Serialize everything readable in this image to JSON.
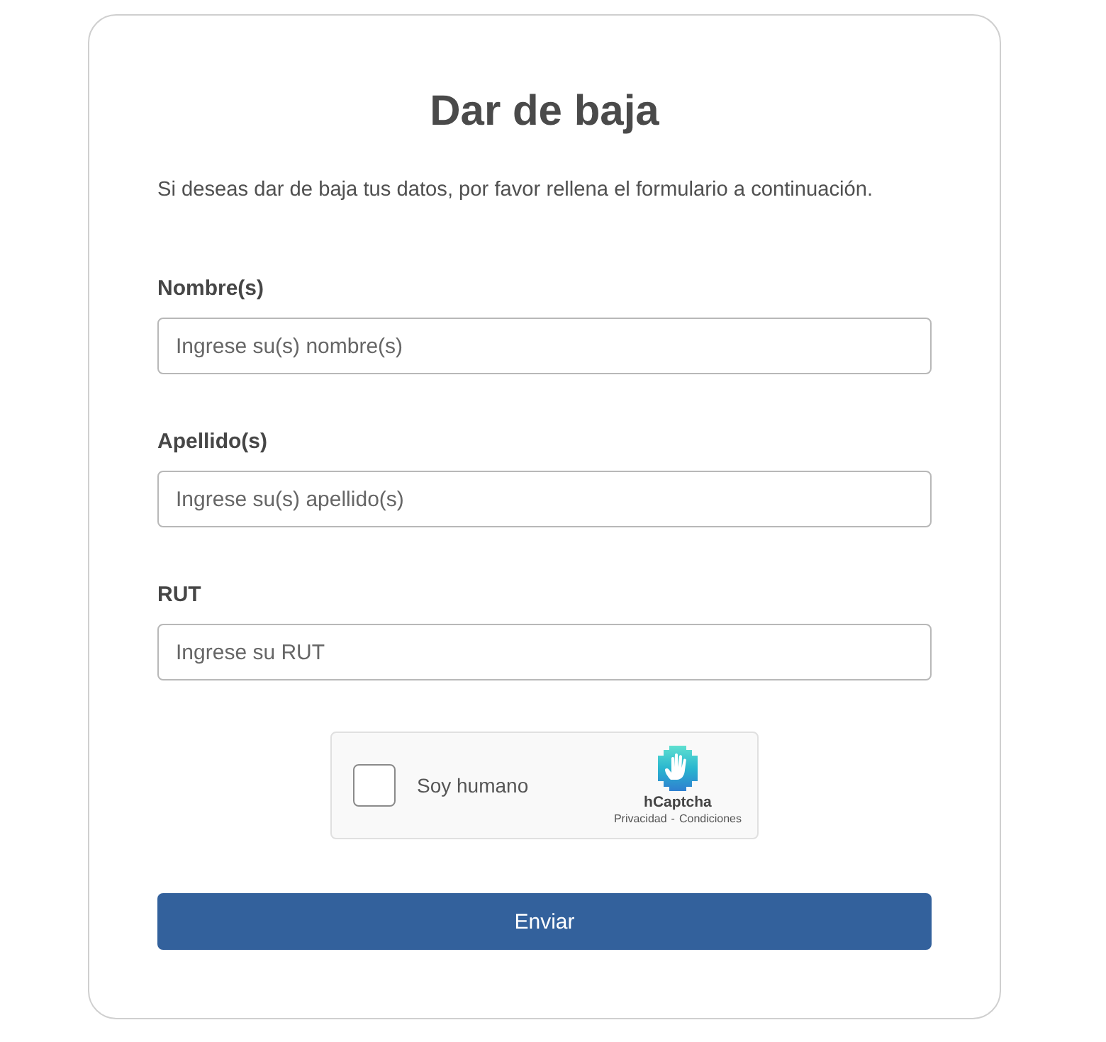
{
  "form": {
    "title": "Dar de baja",
    "intro": "Si deseas dar de baja tus datos, por favor rellena el formulario a continuación."
  },
  "fields": [
    {
      "label": "Nombre(s)",
      "placeholder": "Ingrese su(s) nombre(s)"
    },
    {
      "label": "Apellido(s)",
      "placeholder": "Ingrese su(s) apellido(s)"
    },
    {
      "label": "RUT",
      "placeholder": "Ingrese su RUT"
    }
  ],
  "captcha": {
    "checked": false,
    "label": "Soy humano",
    "brand": "hCaptcha",
    "links": [
      "Privacidad",
      "Condiciones"
    ],
    "separator": "-"
  },
  "submit": {
    "label": "Enviar"
  }
}
